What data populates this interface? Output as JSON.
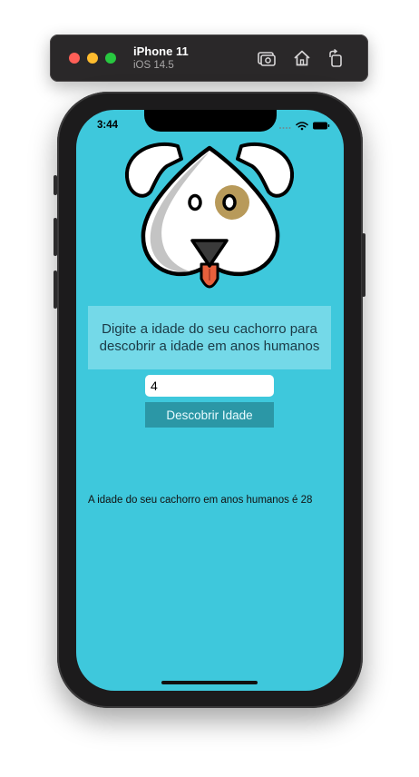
{
  "simulator": {
    "device_name": "iPhone 11",
    "os_version": "iOS 14.5",
    "icons": [
      "screenshot-icon",
      "home-icon",
      "rotate-icon"
    ]
  },
  "status_bar": {
    "time": "3:44"
  },
  "app": {
    "prompt": "Digite a idade do seu cachorro para descobrir a idade em anos humanos",
    "age_input_value": "4",
    "button_label": "Descobrir Idade",
    "result_text": "A idade do seu cachorro em anos humanos é 28"
  },
  "colors": {
    "screen_background": "#3ec8dc",
    "prompt_background": "#74d9e8",
    "button_background": "#2b97a6",
    "dog_spot": "#b89a5a",
    "dog_tongue": "#e8603c"
  }
}
